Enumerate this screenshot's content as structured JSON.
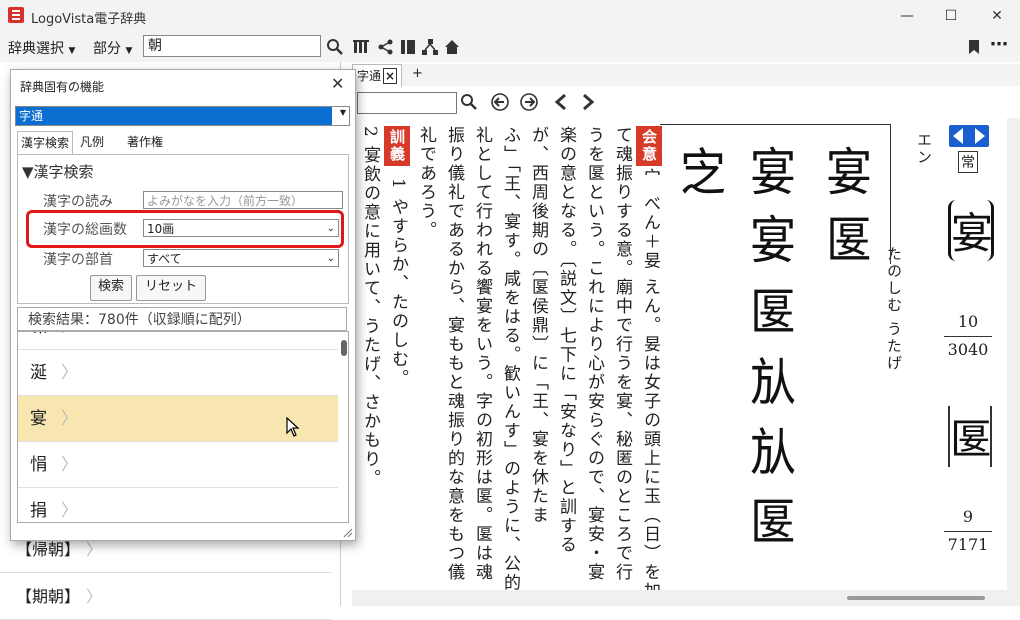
{
  "window": {
    "title": "LogoVista電子辞典",
    "minimize": "—",
    "maximize": "☐",
    "close": "✕"
  },
  "menubar": {
    "dict_select": "辞典選択",
    "part": "部分",
    "search_value": "朝"
  },
  "leftpane": {
    "items": [
      "【帰朝】",
      "【期朝】"
    ]
  },
  "tabs": {
    "current": "字通",
    "close": "×",
    "add": "+"
  },
  "dialog": {
    "title": "辞典固有の機能",
    "close": "✕",
    "dict_value": "字通",
    "tabs": [
      "漢字検索",
      "凡例",
      "著作権"
    ],
    "section_title": "▼漢字検索",
    "reading_label": "漢字の読み",
    "reading_placeholder": "よみがなを入力（前方一致）",
    "strokes_label": "漢字の総画数",
    "strokes_value": "10画",
    "radical_label": "漢字の部首",
    "radical_value": "すべて",
    "search_button": "検索",
    "reset_button": "リセット",
    "results_header": "検索結果：780件（収録順に配列）",
    "results": [
      "凍",
      "涎",
      "宴",
      "悁",
      "捐"
    ]
  },
  "entry": {
    "kanji": "宴",
    "kanji2": "匽",
    "col_right_1": "エン",
    "col_right_2": "たのしむ うたげ",
    "jouyou": "常",
    "strokes1": "10",
    "num1": "3040",
    "strokes2": "9",
    "num2": "7171",
    "label_kaii": "会意",
    "label_kungi": "訓義",
    "body_cols": [
      "宀 べん＋妟 えん。妟は女子の頭上に玉（日）を加え",
      "て魂振りする意。廟中で行うを宴、秘匿のところで行",
      "うを匽という。これにより心が安らぐので、宴安・宴",
      "楽の意となる。〔説文〕七下に「安なり」と訓する",
      "が、西周後期の〔匽侯鼎〕に「王、宴を休たま",
      "ふ」「王、宴す。咸をはる。歓いんす」のように、公的儀",
      "礼として行われる饗宴をいう。字の初形は匽。匽は魂",
      "振り儀礼であるから、宴ももと魂振り的な意をもつ儀",
      "礼であろう。"
    ],
    "kungi_1": "1 やすらか、たのしむ。",
    "kungi_2": "2 宴飲の意に用いて、うたげ、さかもり。",
    "glyphs": [
      "㝎",
      "匽",
      "宴",
      "宴",
      "㫃",
      "匽",
      "宴",
      "匽"
    ]
  }
}
